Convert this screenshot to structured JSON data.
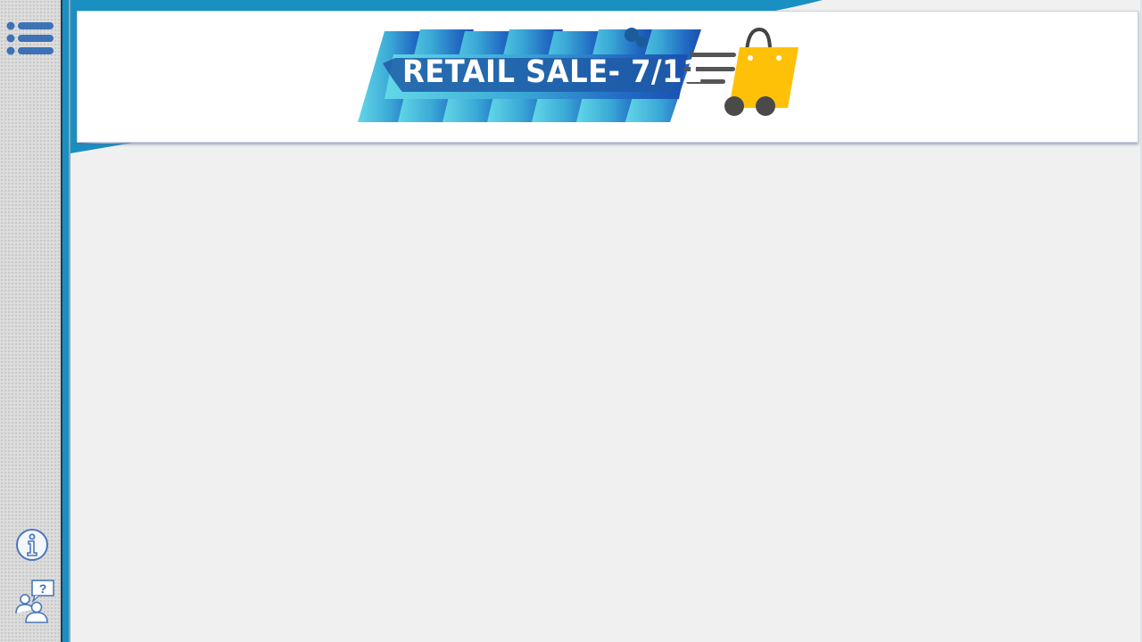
{
  "banner": {
    "title": "RETAIL SALE- 7/11"
  },
  "sidebar": {
    "top": [
      {
        "id": "menu",
        "icon": "list-menu-icon"
      }
    ],
    "bottom": [
      {
        "id": "info",
        "icon": "info-icon"
      },
      {
        "id": "help",
        "icon": "people-question-icon"
      }
    ]
  },
  "colors": {
    "accent_blue": "#1a8fc2",
    "icon_blue": "#3d72b6",
    "cart_yellow": "#ffc107",
    "background": "#f0f0f0"
  }
}
